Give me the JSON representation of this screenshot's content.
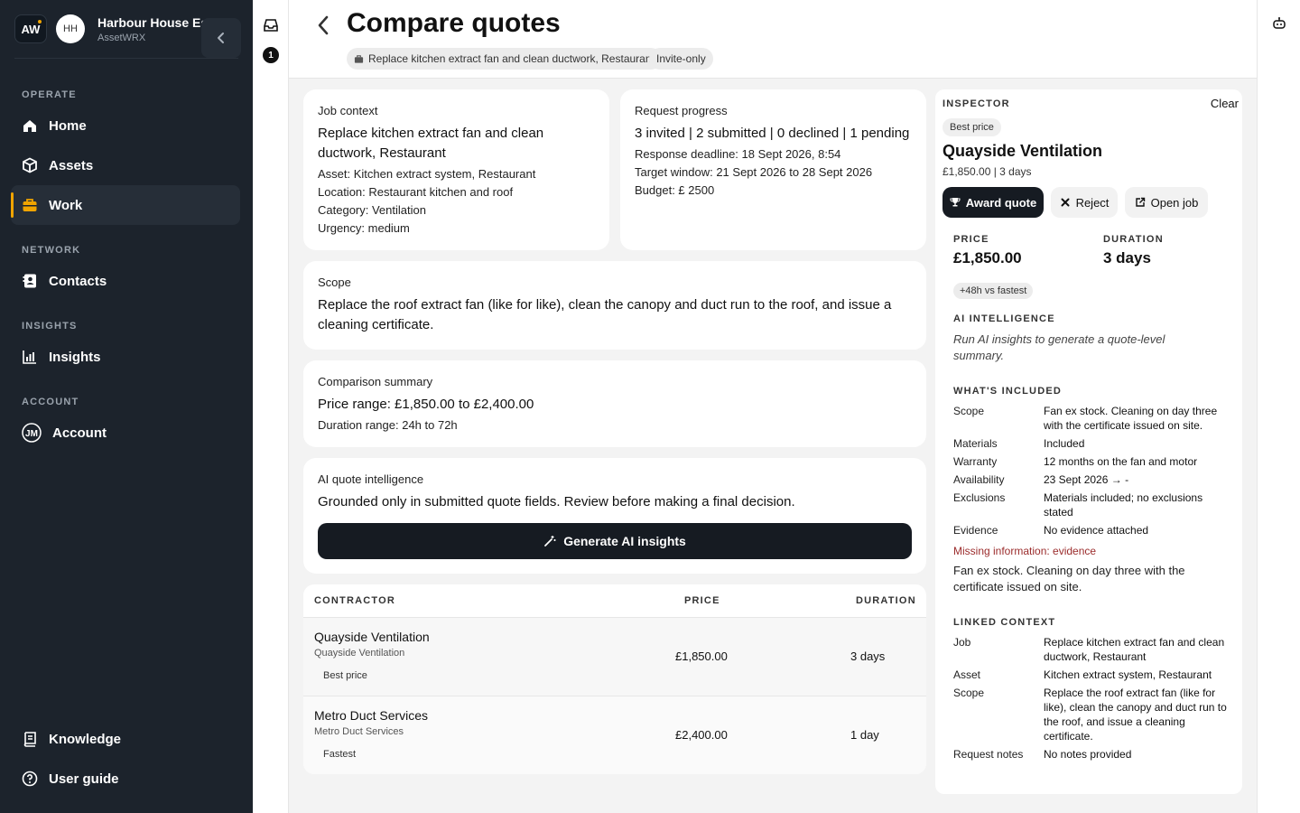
{
  "brand": {
    "logo": "AW",
    "org_initials": "HH",
    "org_name": "Harbour House Es...",
    "org_sub": "AssetWRX"
  },
  "nav": {
    "sections": {
      "operate": "OPERATE",
      "network": "NETWORK",
      "insights": "INSIGHTS",
      "account": "ACCOUNT"
    },
    "home": "Home",
    "assets": "Assets",
    "work": "Work",
    "contacts": "Contacts",
    "insights_item": "Insights",
    "account_item": "Account",
    "knowledge": "Knowledge",
    "user_guide": "User guide"
  },
  "rail": {
    "badge": "1"
  },
  "header": {
    "title": "Compare quotes",
    "job_chip": "Replace kitchen extract fan and clean ductwork, Restaurant",
    "visibility_chip": "Invite-only"
  },
  "job_context": {
    "label": "Job context",
    "title": "Replace kitchen extract fan and clean ductwork, Restaurant",
    "asset": "Asset: Kitchen extract system, Restaurant",
    "location": "Location: Restaurant kitchen and roof",
    "category": "Category: Ventilation",
    "urgency": "Urgency: medium"
  },
  "request_progress": {
    "label": "Request progress",
    "summary": "3 invited | 2 submitted | 0 declined | 1 pending",
    "deadline": "Response deadline: 18 Sept 2026, 8:54",
    "window": "Target window: 21 Sept 2026 to 28 Sept 2026",
    "budget": "Budget: £ 2500"
  },
  "scope": {
    "label": "Scope",
    "text": "Replace the roof extract fan (like for like), clean the canopy and duct run to the roof, and issue a cleaning certificate."
  },
  "comparison": {
    "label": "Comparison summary",
    "price_range": "Price range: £1,850.00 to £2,400.00",
    "duration_range": "Duration range: 24h to 72h"
  },
  "ai_quote": {
    "label": "AI quote intelligence",
    "text": "Grounded only in submitted quote fields. Review before making a final decision.",
    "button": "Generate AI insights"
  },
  "table": {
    "headers": {
      "contractor": "CONTRACTOR",
      "price": "PRICE",
      "duration": "DURATION"
    },
    "rows": [
      {
        "name": "Quayside Ventilation",
        "sub": "Quayside Ventilation",
        "tag": "Best price",
        "price": "£1,850.00",
        "duration": "3 days"
      },
      {
        "name": "Metro Duct Services",
        "sub": "Metro Duct Services",
        "tag": "Fastest",
        "price": "£2,400.00",
        "duration": "1 day"
      }
    ]
  },
  "inspector": {
    "heading": "INSPECTOR",
    "clear": "Clear",
    "tag": "Best price",
    "name": "Quayside Ventilation",
    "summary": "£1,850.00 | 3 days",
    "award": "Award quote",
    "reject": "Reject",
    "open_job": "Open job",
    "price_label": "PRICE",
    "price_value": "£1,850.00",
    "duration_label": "DURATION",
    "duration_value": "3 days",
    "vs_fastest": "+48h vs fastest",
    "ai_heading": "AI INTELLIGENCE",
    "ai_note": "Run AI insights to generate a quote-level summary.",
    "included_heading": "WHAT'S INCLUDED",
    "included": {
      "scope_k": "Scope",
      "scope_v": "Fan ex stock. Cleaning on day three with the certificate issued on site.",
      "materials_k": "Materials",
      "materials_v": "Included",
      "warranty_k": "Warranty",
      "warranty_v": "12 months on the fan and motor",
      "availability_k": "Availability",
      "availability_v": "23 Sept 2026 → -",
      "exclusions_k": "Exclusions",
      "exclusions_v": "Materials included; no exclusions stated",
      "evidence_k": "Evidence",
      "evidence_v": "No evidence attached"
    },
    "missing": "Missing information: evidence",
    "fan_note": "Fan ex stock. Cleaning on day three with the certificate issued on site.",
    "linked_heading": "LINKED CONTEXT",
    "linked": {
      "job_k": "Job",
      "job_v": "Replace kitchen extract fan and clean ductwork, Restaurant",
      "asset_k": "Asset",
      "asset_v": "Kitchen extract system, Restaurant",
      "scope_k": "Scope",
      "scope_v": "Replace the roof extract fan (like for like), clean the canopy and duct run to the roof, and issue a cleaning certificate.",
      "notes_k": "Request notes",
      "notes_v": "No notes provided"
    }
  }
}
